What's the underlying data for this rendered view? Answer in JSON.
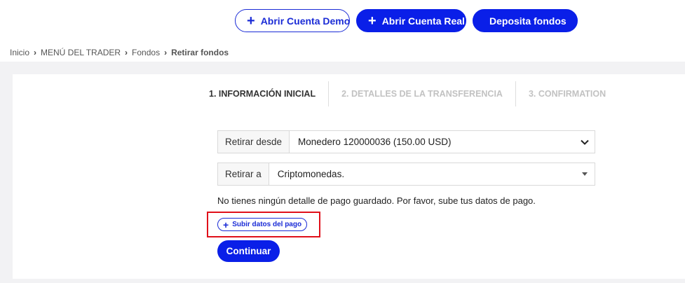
{
  "top_actions": {
    "demo_label": "Abrir Cuenta Demo",
    "real_label": "Abrir Cuenta Real",
    "deposit_label": "Deposita fondos"
  },
  "breadcrumb": {
    "items": [
      "Inicio",
      "MENÚ DEL TRADER",
      "Fondos"
    ],
    "current": "Retirar fondos"
  },
  "steps": [
    {
      "label": "1. INFORMACIÓN INICIAL",
      "state": "active"
    },
    {
      "label": "2. DETALLES DE LA TRANSFERENCIA",
      "state": "inactive"
    },
    {
      "label": "3. CONFIRMATION",
      "state": "inactive"
    }
  ],
  "form": {
    "withdraw_from_label": "Retirar desde",
    "withdraw_from_value": "Monedero 120000036 (150.00 USD)",
    "withdraw_to_label": "Retirar a",
    "withdraw_to_value": "Criptomonedas.",
    "notice": "No tienes ningún detalle de pago guardado. Por favor, sube tus datos de pago.",
    "upload_label": "Subir datos del pago",
    "continue_label": "Continuar"
  },
  "colors": {
    "brand_blue": "#0a1fe8",
    "highlight_red": "#e0101a",
    "background_gray": "#f2f2f4"
  }
}
